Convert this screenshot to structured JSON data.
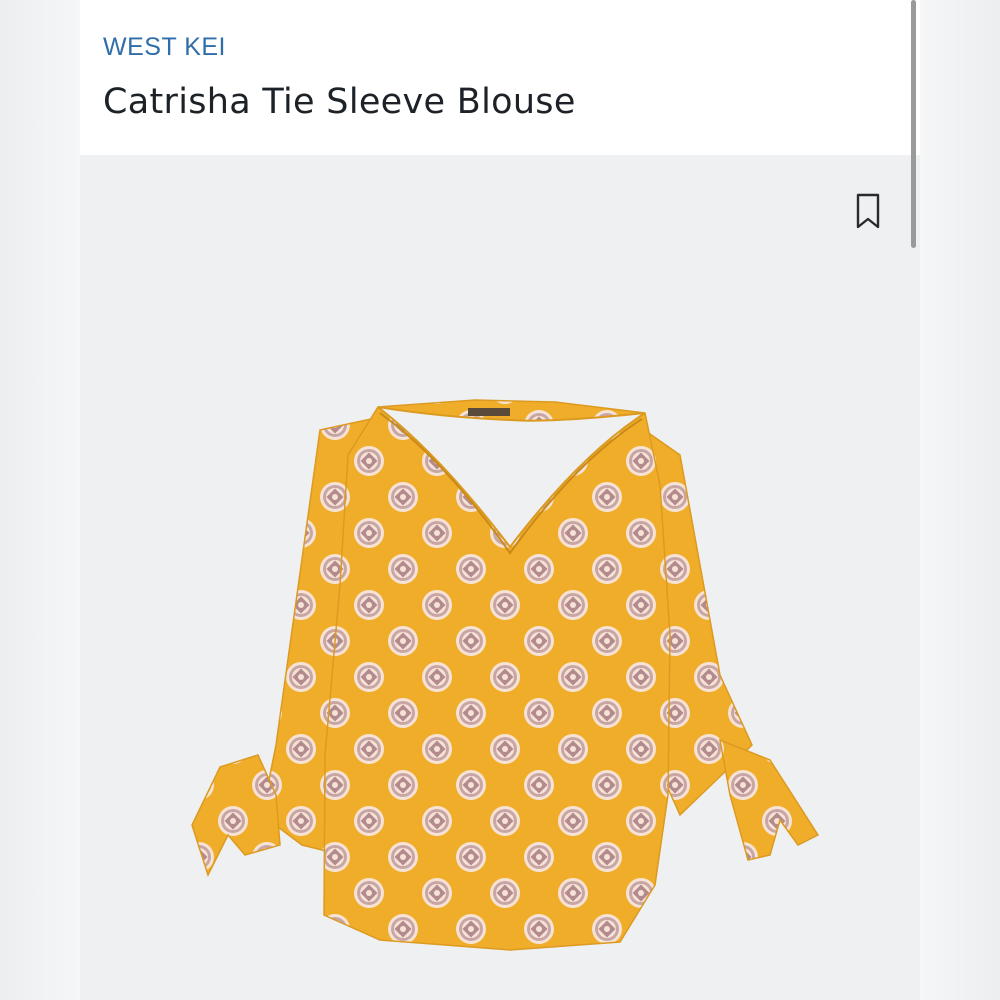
{
  "product": {
    "brand": "WEST KEI",
    "title": "Catrisha Tie Sleeve Blouse"
  },
  "icons": {
    "bookmark": "bookmark-icon"
  },
  "colors": {
    "brand": "#2f6ea8",
    "title": "#1d2228",
    "blouse": "#f0ad2a",
    "image_background": "#eef0f2"
  }
}
